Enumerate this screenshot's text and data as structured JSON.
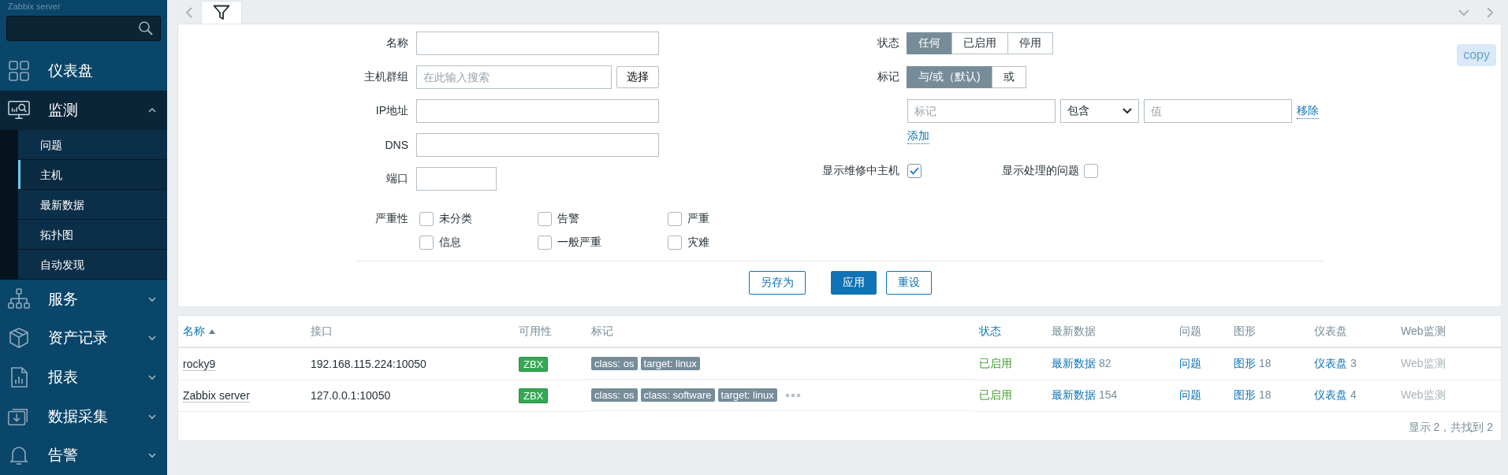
{
  "sidebar": {
    "server_name": "Zabbix server",
    "items": [
      {
        "kind": "dashboard",
        "label": "仪表盘",
        "expanded": false
      },
      {
        "kind": "monitor",
        "label": "监测",
        "expanded": true,
        "children": [
          {
            "label": "问题",
            "selected": false
          },
          {
            "label": "主机",
            "selected": true
          },
          {
            "label": "最新数据",
            "selected": false
          },
          {
            "label": "拓扑图",
            "selected": false
          },
          {
            "label": "自动发现",
            "selected": false
          }
        ]
      },
      {
        "kind": "services",
        "label": "服务",
        "expanded": false
      },
      {
        "kind": "inventory",
        "label": "资产记录",
        "expanded": false
      },
      {
        "kind": "reports",
        "label": "报表",
        "expanded": false
      },
      {
        "kind": "datacollection",
        "label": "数据采集",
        "expanded": false
      },
      {
        "kind": "alerts",
        "label": "告警",
        "expanded": false
      }
    ]
  },
  "filter": {
    "fields": [
      {
        "label": "名称",
        "kind": "wide"
      },
      {
        "label": "主机群组",
        "placeholder": "在此输入搜索",
        "kind": "wide",
        "button": "选择"
      },
      {
        "label": "IP地址",
        "kind": "wide"
      },
      {
        "label": "DNS",
        "kind": "wide"
      },
      {
        "label": "端口",
        "kind": "narrow"
      }
    ],
    "severity": {
      "label": "严重性",
      "options": [
        {
          "label": "未分类",
          "checked": false
        },
        {
          "label": "告警",
          "checked": false
        },
        {
          "label": "严重",
          "checked": false
        },
        {
          "label": "信息",
          "checked": false
        },
        {
          "label": "一般严重",
          "checked": false
        },
        {
          "label": "灾难",
          "checked": false
        }
      ]
    },
    "status": {
      "label": "状态",
      "options": [
        {
          "label": "任何",
          "selected": true
        },
        {
          "label": "已启用",
          "selected": false
        },
        {
          "label": "停用",
          "selected": false
        }
      ]
    },
    "tags": {
      "label": "标记",
      "options": [
        {
          "label": "与/或（默认)",
          "selected": true
        },
        {
          "label": "或",
          "selected": false
        }
      ],
      "tag_placeholder": "标记",
      "operator": "包含",
      "value_placeholder": "值",
      "remove": "移除",
      "add": "添加"
    },
    "show_maintenance": {
      "label": "显示维修中主机",
      "checked": true
    },
    "show_suppressed": {
      "label": "显示处理的问题",
      "checked": false
    },
    "copy": "copy",
    "buttons": [
      {
        "label": "另存为",
        "kind": "outline"
      },
      {
        "label": "应用",
        "kind": "primary"
      },
      {
        "label": "重设",
        "kind": "outline"
      }
    ]
  },
  "table": {
    "columns": [
      {
        "label": "名称",
        "kind": "sortable",
        "sorted": true
      },
      {
        "label": "接口",
        "kind": "plain"
      },
      {
        "label": "可用性",
        "kind": "plain"
      },
      {
        "label": "标记",
        "kind": "plain"
      },
      {
        "label": "状态",
        "kind": "sortable",
        "sorted": false
      },
      {
        "label": "最新数据",
        "kind": "plain"
      },
      {
        "label": "问题",
        "kind": "plain"
      },
      {
        "label": "图形",
        "kind": "plain"
      },
      {
        "label": "仪表盘",
        "kind": "plain"
      },
      {
        "label": "Web监测",
        "kind": "plain"
      }
    ],
    "rows": [
      {
        "name": "rocky9",
        "interface": "192.168.115.224:10050",
        "availability": "ZBX",
        "tags": [
          "class: os",
          "target: linux"
        ],
        "more_tags": false,
        "status": "已启用",
        "latest": "最新数据",
        "latest_count": "82",
        "problems": "问题",
        "graphs": "图形",
        "graphs_count": "18",
        "dashboards": "仪表盘",
        "dashboards_count": "3",
        "web": "Web监测"
      },
      {
        "name": "Zabbix server",
        "interface": "127.0.0.1:10050",
        "availability": "ZBX",
        "tags": [
          "class: os",
          "class: software",
          "target: linux"
        ],
        "more_tags": true,
        "status": "已启用",
        "latest": "最新数据",
        "latest_count": "154",
        "problems": "问题",
        "graphs": "图形",
        "graphs_count": "18",
        "dashboards": "仪表盘",
        "dashboards_count": "4",
        "web": "Web监测"
      }
    ],
    "footer": "显示 2，共找到 2"
  }
}
